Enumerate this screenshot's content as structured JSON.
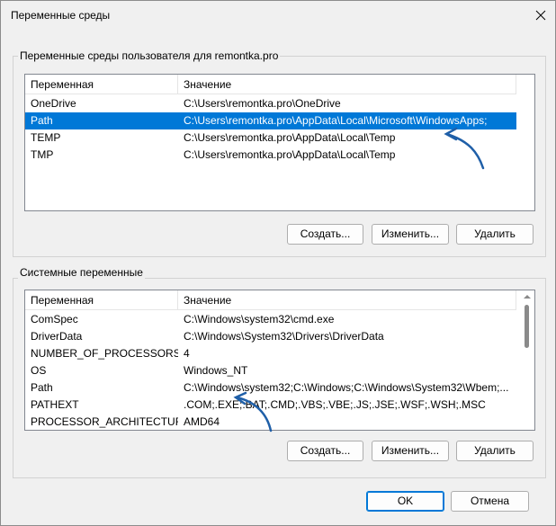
{
  "window": {
    "title": "Переменные среды"
  },
  "user_vars": {
    "group_label": "Переменные среды пользователя для remontka.pro",
    "columns": [
      "Переменная",
      "Значение"
    ],
    "rows": [
      {
        "name": "OneDrive",
        "value": "C:\\Users\\remontka.pro\\OneDrive",
        "selected": false
      },
      {
        "name": "Path",
        "value": "C:\\Users\\remontka.pro\\AppData\\Local\\Microsoft\\WindowsApps;",
        "selected": true
      },
      {
        "name": "TEMP",
        "value": "C:\\Users\\remontka.pro\\AppData\\Local\\Temp",
        "selected": false
      },
      {
        "name": "TMP",
        "value": "C:\\Users\\remontka.pro\\AppData\\Local\\Temp",
        "selected": false
      }
    ],
    "buttons": {
      "new": "Создать...",
      "edit": "Изменить...",
      "delete": "Удалить"
    }
  },
  "system_vars": {
    "group_label": "Системные переменные",
    "columns": [
      "Переменная",
      "Значение"
    ],
    "rows": [
      {
        "name": "ComSpec",
        "value": "C:\\Windows\\system32\\cmd.exe"
      },
      {
        "name": "DriverData",
        "value": "C:\\Windows\\System32\\Drivers\\DriverData"
      },
      {
        "name": "NUMBER_OF_PROCESSORS",
        "value": "4"
      },
      {
        "name": "OS",
        "value": "Windows_NT"
      },
      {
        "name": "Path",
        "value": "C:\\Windows\\system32;C:\\Windows;C:\\Windows\\System32\\Wbem;..."
      },
      {
        "name": "PATHEXT",
        "value": ".COM;.EXE;.BAT;.CMD;.VBS;.VBE;.JS;.JSE;.WSF;.WSH;.MSC"
      },
      {
        "name": "PROCESSOR_ARCHITECTURE",
        "value": "AMD64"
      }
    ],
    "buttons": {
      "new": "Создать...",
      "edit": "Изменить...",
      "delete": "Удалить"
    }
  },
  "dialog_buttons": {
    "ok": "OK",
    "cancel": "Отмена"
  },
  "colors": {
    "selection": "#0078d7",
    "annotation_arrow": "#1f5fa8"
  },
  "icons": {
    "close": "close-icon",
    "annotation": "annotation-arrow-icon"
  }
}
